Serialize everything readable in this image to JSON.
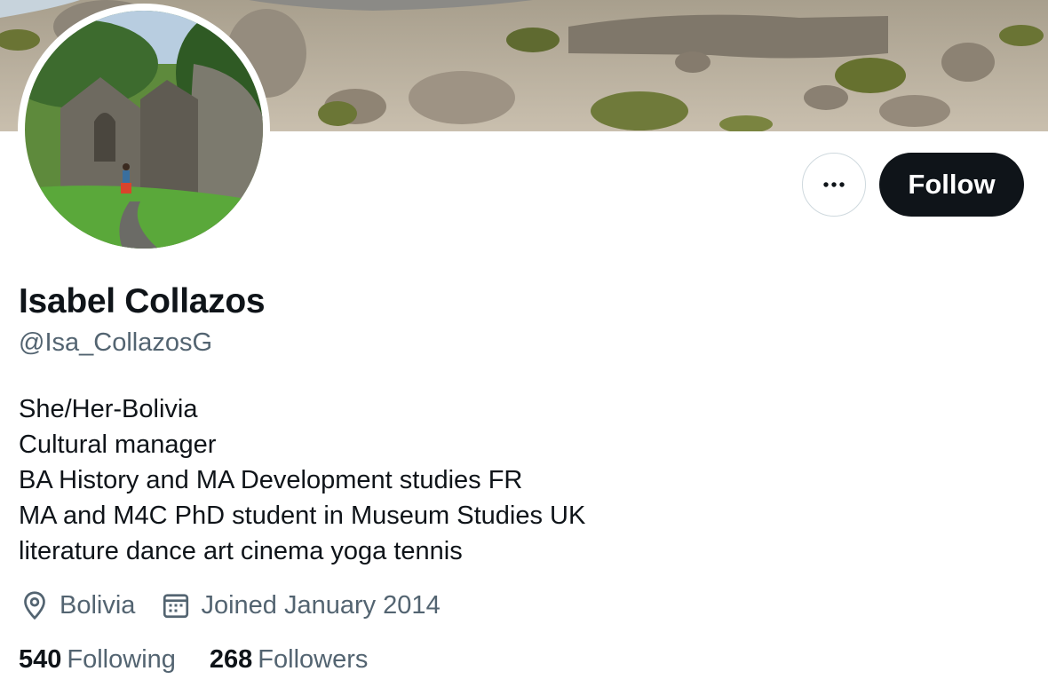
{
  "profile": {
    "name": "Isabel Collazos",
    "handle": "@Isa_CollazosG",
    "bio": [
      "She/Her-Bolivia",
      "Cultural manager",
      "BA History and MA Development studies FR",
      "MA and M4C PhD student in Museum Studies UK",
      "literature dance art cinema yoga tennis"
    ],
    "location": "Bolivia",
    "joined": "Joined January 2014"
  },
  "stats": {
    "following_count": "540",
    "following_label": "Following",
    "followers_count": "268",
    "followers_label": "Followers"
  },
  "actions": {
    "follow_label": "Follow",
    "more_icon": "more-horizontal-icon"
  },
  "icons": {
    "location": "location-pin-icon",
    "calendar": "calendar-icon"
  },
  "colors": {
    "primary_text": "#0f1419",
    "secondary_text": "#536471",
    "button_bg": "#0f1419",
    "border": "#cfd9de"
  }
}
